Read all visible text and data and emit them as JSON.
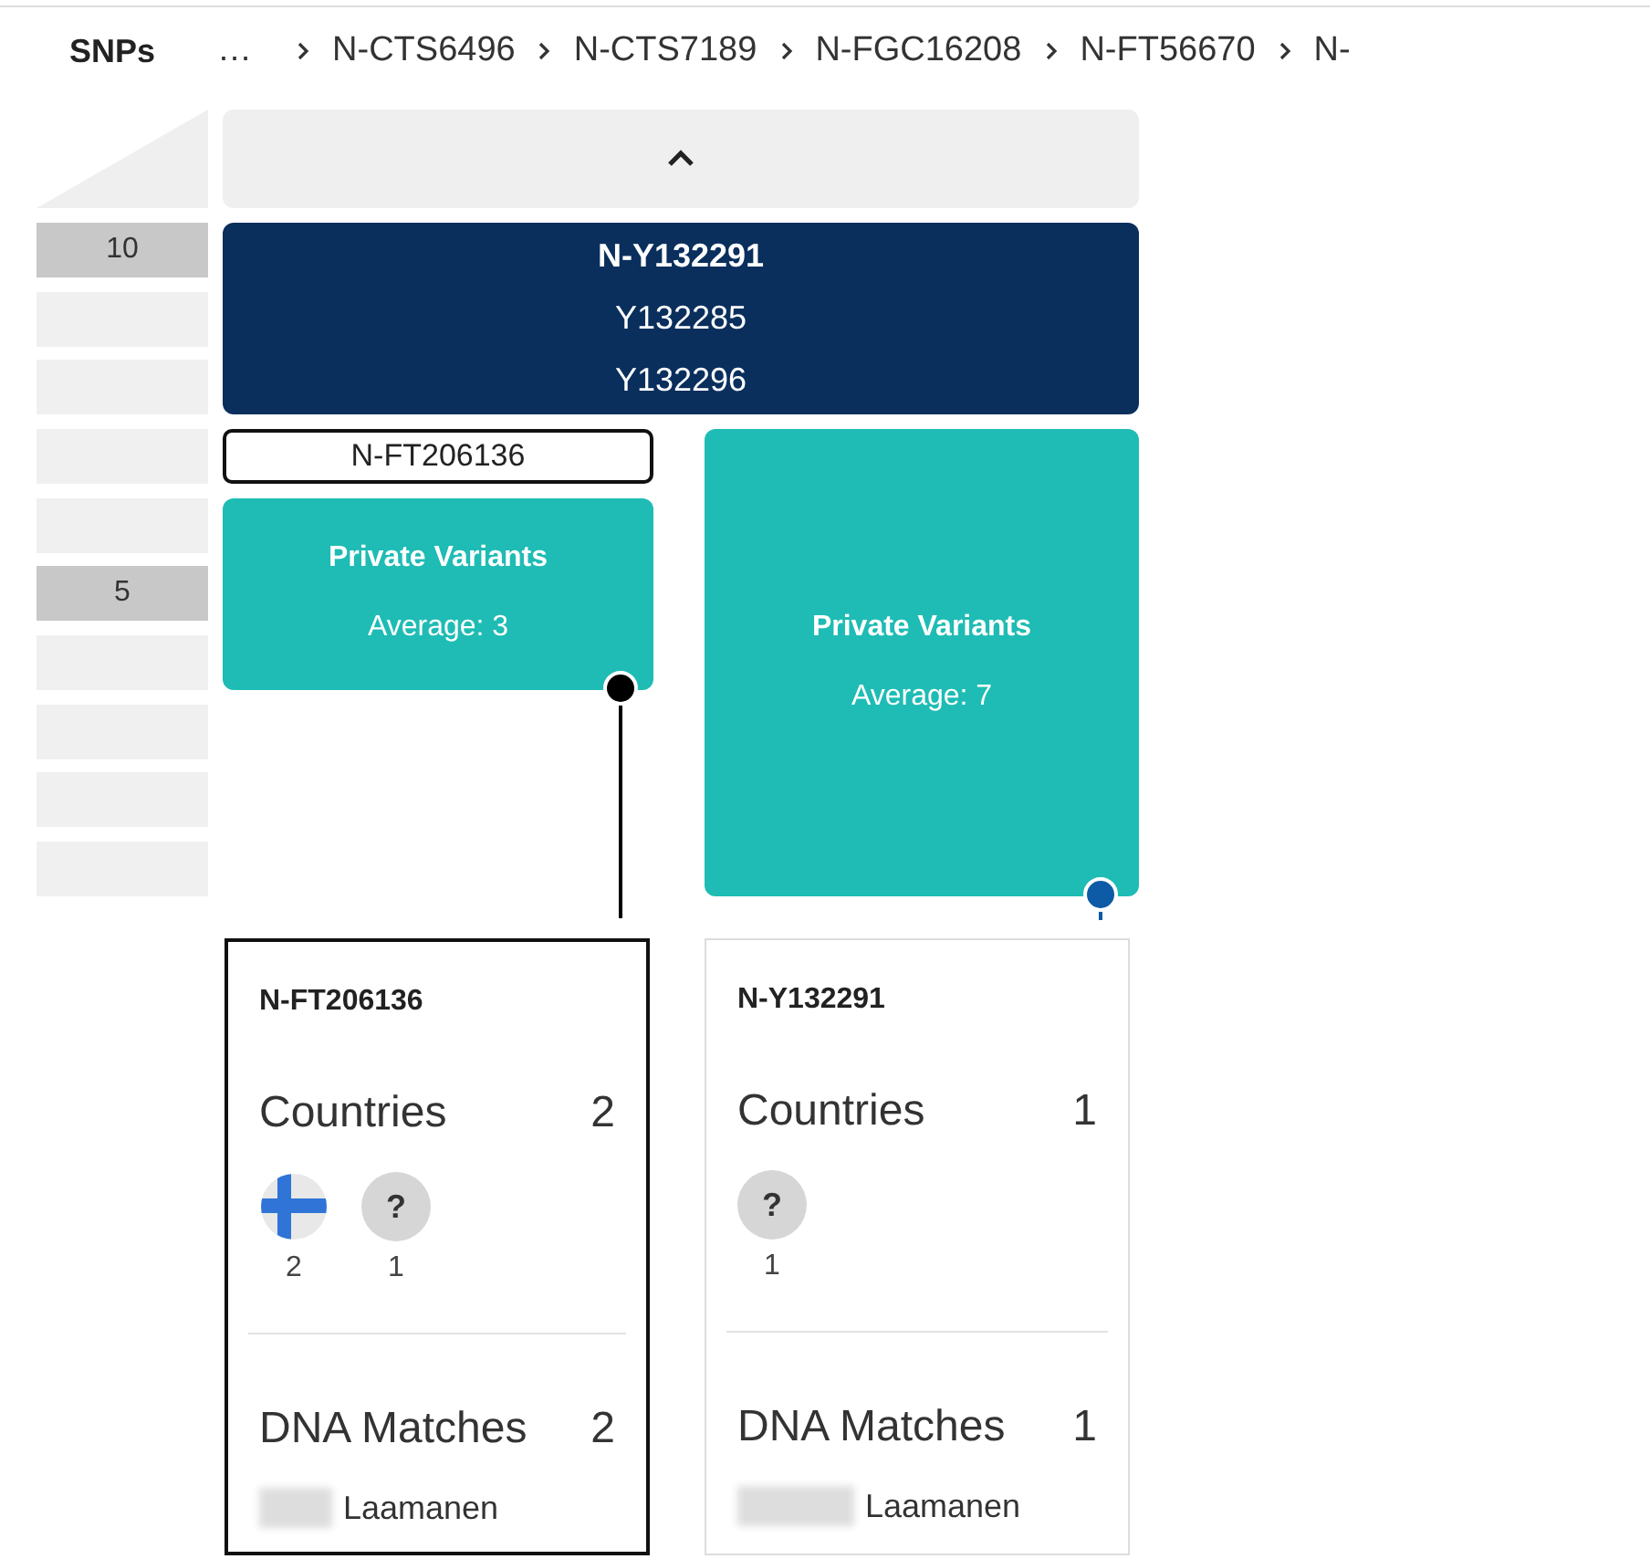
{
  "breadcrumb": {
    "label": "SNPs",
    "items": [
      "…",
      "N-CTS6496",
      "N-CTS7189",
      "N-FGC16208",
      "N-FT56670",
      "N-"
    ]
  },
  "scale": [
    {
      "label": "10",
      "highlighted": true
    },
    {
      "highlighted": false
    },
    {
      "highlighted": false
    },
    {
      "highlighted": false
    },
    {
      "highlighted": false
    },
    {
      "label": "5",
      "highlighted": true
    },
    {
      "highlighted": false
    },
    {
      "highlighted": false
    },
    {
      "highlighted": false
    },
    {
      "highlighted": false
    }
  ],
  "parent_node": {
    "name": "N-Y132291",
    "snps": [
      "Y132285",
      "Y132296"
    ]
  },
  "branches": [
    {
      "label": "N-FT206136",
      "selected": true,
      "private_variants": {
        "title": "Private Variants",
        "average": "Average: 3"
      },
      "detail": {
        "name": "N-FT206136",
        "countries_label": "Countries",
        "countries_count": "2",
        "countries": [
          {
            "kind": "flag",
            "count": "2"
          },
          {
            "kind": "unknown",
            "symbol": "?",
            "count": "1"
          }
        ],
        "matches_label": "DNA Matches",
        "matches_count": "2",
        "matches": [
          {
            "name": "Laamanen"
          }
        ]
      }
    },
    {
      "selected": false,
      "private_variants": {
        "title": "Private Variants",
        "average": "Average: 7"
      },
      "detail": {
        "name": "N-Y132291",
        "countries_label": "Countries",
        "countries_count": "1",
        "countries": [
          {
            "kind": "unknown",
            "symbol": "?",
            "count": "1"
          }
        ],
        "matches_label": "DNA Matches",
        "matches_count": "1",
        "matches": [
          {
            "name": "Laamanen"
          }
        ]
      }
    }
  ]
}
